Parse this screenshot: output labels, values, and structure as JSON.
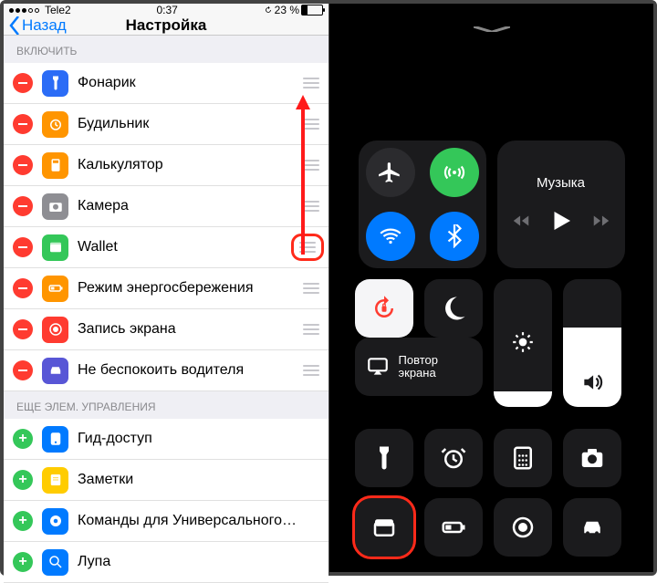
{
  "status": {
    "carrier": "Tele2",
    "time": "0:37",
    "battery_pct": "23 %"
  },
  "nav": {
    "back": "Назад",
    "title": "Настройка"
  },
  "sections": {
    "include": "Включить",
    "more": "Еще элем. управления"
  },
  "include_items": [
    {
      "label": "Фонарик",
      "icon": "flashlight",
      "color": "#2b6cf6"
    },
    {
      "label": "Будильник",
      "icon": "alarm",
      "color": "#ff9500"
    },
    {
      "label": "Калькулятор",
      "icon": "calculator",
      "color": "#ff9500"
    },
    {
      "label": "Камера",
      "icon": "camera",
      "color": "#8e8e93"
    },
    {
      "label": "Wallet",
      "icon": "wallet",
      "color": "#34c759"
    },
    {
      "label": "Режим энергосбережения",
      "icon": "lowpower",
      "color": "#ff9500"
    },
    {
      "label": "Запись экрана",
      "icon": "record",
      "color": "#ff3b30"
    },
    {
      "label": "Не беспокоить водителя",
      "icon": "car",
      "color": "#5856d6"
    }
  ],
  "more_items": [
    {
      "label": "Гид-доступ",
      "icon": "guided",
      "color": "#007aff"
    },
    {
      "label": "Заметки",
      "icon": "notes",
      "color": "#ffcc00"
    },
    {
      "label": "Команды для Универсального…",
      "icon": "universal",
      "color": "#007aff"
    },
    {
      "label": "Лупа",
      "icon": "magnifier",
      "color": "#007aff"
    }
  ],
  "cc": {
    "music_label": "Музыка",
    "mirror_label": "Повтор экрана"
  }
}
